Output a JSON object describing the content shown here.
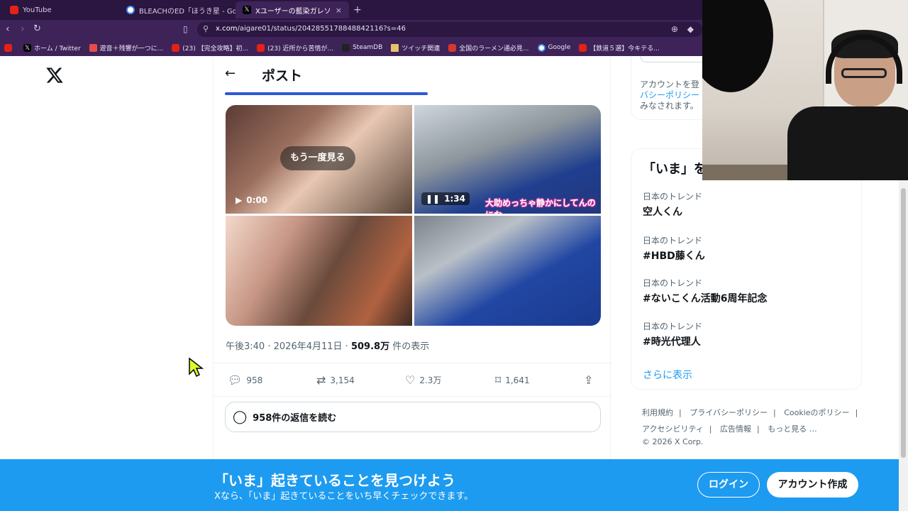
{
  "browser": {
    "tabs": [
      {
        "label": "YouTube",
        "icon": "youtube-icon",
        "active": false
      },
      {
        "label": "BLEACHのED「ほうき星 - Google 検索",
        "icon": "google-icon",
        "active": false
      },
      {
        "label": "Xユーザーの藍染ガレソの悲報（藤",
        "icon": "x-icon",
        "active": true
      }
    ],
    "new_tab": "+",
    "close_tab": "×",
    "url_host": "x.com",
    "url_path": "/aigare01/status/2042855178848842116?s=46",
    "bookmarks": [
      {
        "label": "",
        "icon": "youtube-icon"
      },
      {
        "label": "ホーム / Twitter",
        "icon": "x-icon"
      },
      {
        "label": "遊音＋残響が一つに...",
        "icon": "red-icon"
      },
      {
        "label": "(23) 【完全攻略】初...",
        "icon": "youtube-icon"
      },
      {
        "label": "(23) 近所から苦情が...",
        "icon": "youtube-icon"
      },
      {
        "label": "SteamDB",
        "icon": "steam-icon"
      },
      {
        "label": "ツイッチ関連",
        "icon": "folder-icon"
      },
      {
        "label": "全国のラーメン通必見...",
        "icon": "red-icon"
      },
      {
        "label": "Google",
        "icon": "google-icon"
      },
      {
        "label": "【鉄道５選】今キテる...",
        "icon": "youtube-icon"
      }
    ]
  },
  "post": {
    "header_title": "ポスト",
    "back_icon": "←",
    "replay_label": "もう一度見る",
    "video1_time": "0:00",
    "video2_time": "1:34",
    "video2_caption": "大助めっちゃ静かにしてんのにな",
    "time": "午後3:40",
    "date": "2026年4月11日",
    "views_count": "509.8万",
    "views_suffix": "件の表示",
    "sep": "·",
    "actions": {
      "replies": "958",
      "reposts": "3,154",
      "likes": "2.3万",
      "bookmarks": "1,641"
    },
    "read_replies": "958件の返信を読む"
  },
  "sidebar": {
    "notice_text_1": "アカウントを登",
    "notice_link": "バシーポリシー",
    "notice_text_2": "みなされます。",
    "trends_title": "「いま」を",
    "trends": [
      {
        "label": "日本のトレンド",
        "title": "空人くん"
      },
      {
        "label": "日本のトレンド",
        "title": "#HBD藤くん"
      },
      {
        "label": "日本のトレンド",
        "title": "#ないこくん活動6周年記念"
      },
      {
        "label": "日本のトレンド",
        "title": "#時光代理人"
      }
    ],
    "show_more": "さらに表示",
    "footer": {
      "terms": "利用規約",
      "privacy": "プライバシーポリシー",
      "cookie": "Cookieのポリシー",
      "accessibility": "アクセシビリティ",
      "ads": "広告情報",
      "more": "もっと見る …",
      "copyright": "© 2026 X Corp."
    }
  },
  "banner": {
    "headline": "「いま」起きていることを見つけよう",
    "subtext": "Xなら、「いま」起きていることをいち早くチェックできます。",
    "login": "ログイン",
    "signup": "アカウント作成"
  },
  "colors": {
    "accent": "#1d9bf0",
    "browser_frame": "#3d2357",
    "post_tab_underline": "#2e58d6"
  }
}
